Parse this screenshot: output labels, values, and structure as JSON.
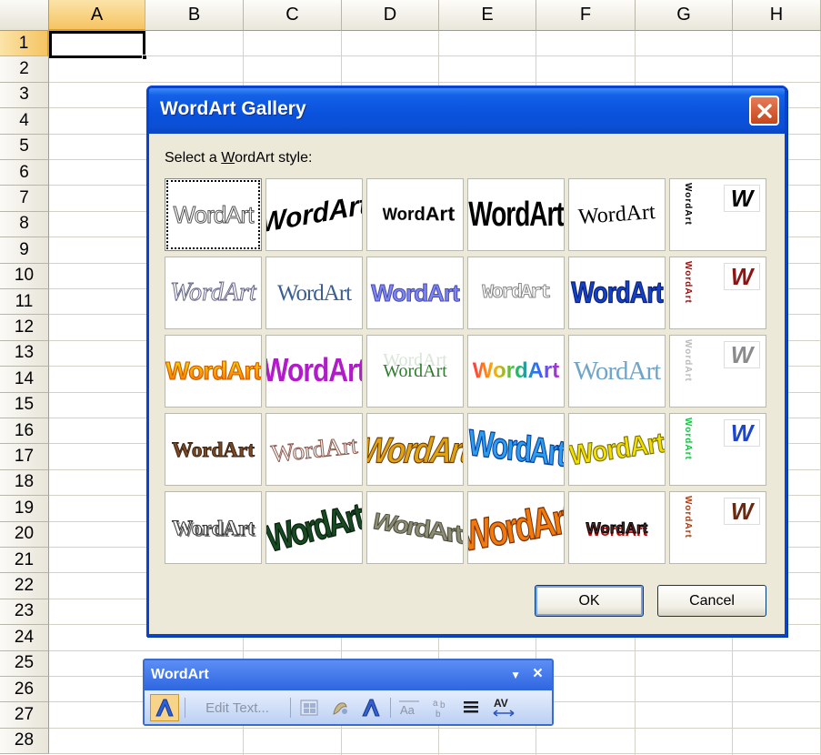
{
  "spreadsheet": {
    "columns": [
      "A",
      "B",
      "C",
      "D",
      "E",
      "F",
      "G",
      "H"
    ],
    "rows": [
      "1",
      "2",
      "3",
      "4",
      "5",
      "6",
      "7",
      "8",
      "9",
      "10",
      "11",
      "12",
      "13",
      "14",
      "15",
      "16",
      "17",
      "18",
      "19",
      "20",
      "21",
      "22",
      "23",
      "24",
      "25",
      "26",
      "27",
      "28"
    ],
    "selected_column": "A",
    "selected_row": "1",
    "header_highlight_color": "#f5c462"
  },
  "dialog": {
    "title": "WordArt Gallery",
    "prompt_prefix": "Select a ",
    "prompt_underlined": "W",
    "prompt_suffix": "ordArt style:",
    "ok_label": "OK",
    "cancel_label": "Cancel",
    "title_color": "#0a52dc",
    "styles": [
      [
        "WordArt",
        "WordArt",
        "WordArt",
        "WordArt",
        "WordArt",
        "W"
      ],
      [
        "WordArt",
        "WordArt",
        "WordArt",
        "WordArt",
        "WordArt",
        "W"
      ],
      [
        "WordArt",
        "WordArt",
        "WordArt",
        "WordArt",
        "WordArt",
        "W"
      ],
      [
        "WordArt",
        "WordArt",
        "WordArt",
        "WordArt",
        "WordArt",
        "W"
      ],
      [
        "WordArt",
        "WordArt",
        "WordArt",
        "WordArt",
        "WordArt",
        "W"
      ]
    ],
    "selected_style": [
      0,
      0
    ]
  },
  "toolbar": {
    "title": "WordArt",
    "dropdown_glyph": "▼",
    "close_glyph": "×",
    "edit_text_label": "Edit Text...",
    "icons": [
      "insert-wordart-icon",
      "wordart-gallery-icon",
      "format-wordart-icon",
      "wordart-shape-icon",
      "same-letter-heights-icon",
      "vertical-text-icon",
      "alignment-icon",
      "character-spacing-icon"
    ]
  }
}
